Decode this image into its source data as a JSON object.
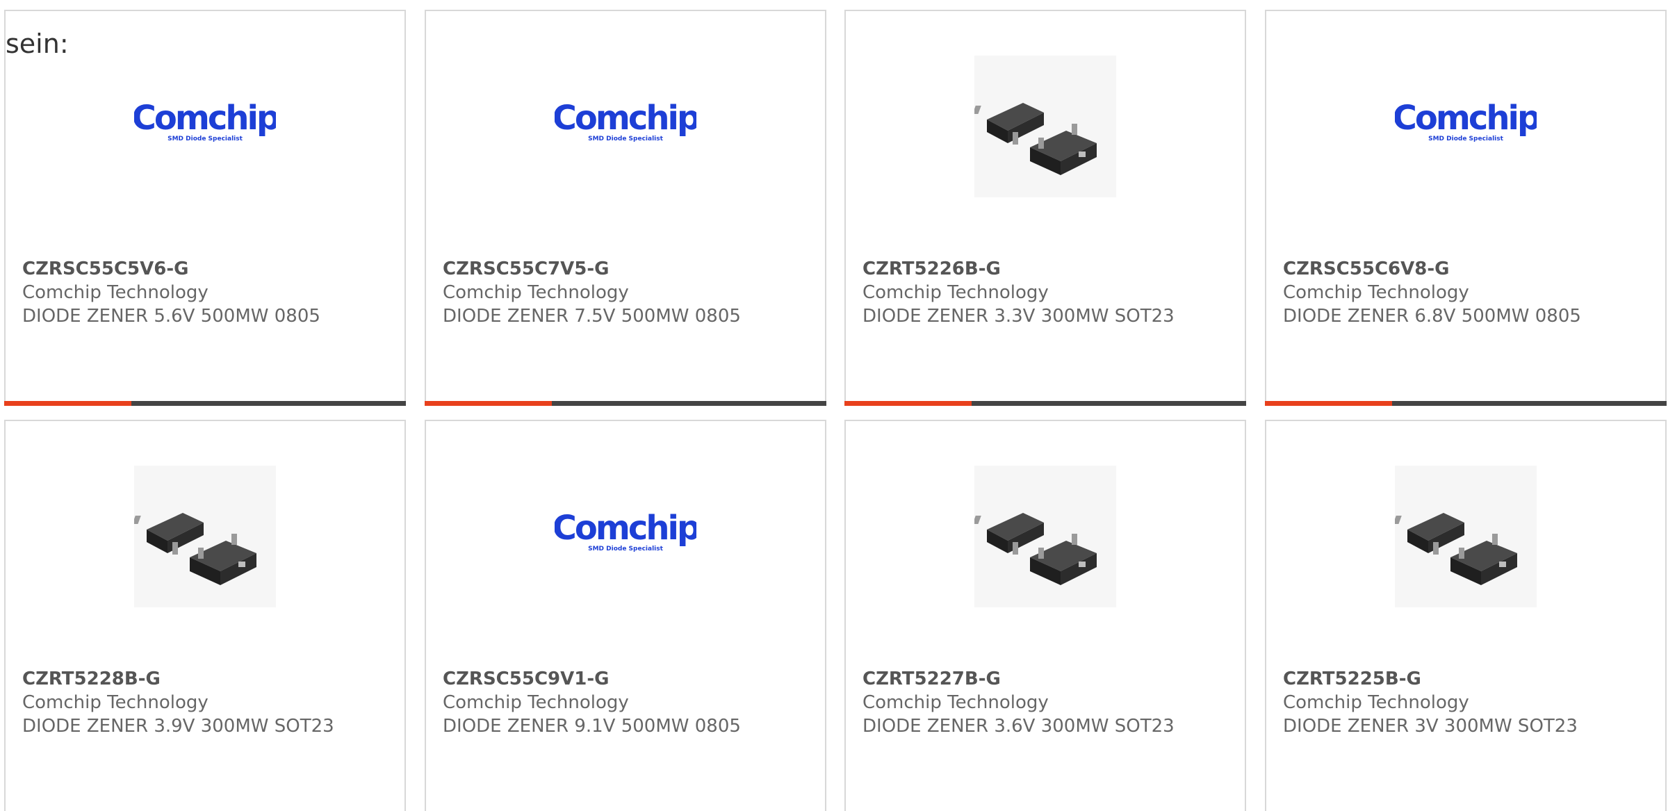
{
  "intro_text": "sein:",
  "colors": {
    "accent": "#e8401c",
    "bar_dark": "#444444",
    "logo_blue": "#1d3fd6"
  },
  "logo": {
    "brand": "Comchip",
    "tagline": "SMD Diode Specialist"
  },
  "products": [
    {
      "part": "CZRSC55C5V6-G",
      "maker": "Comchip Technology",
      "desc": "DIODE ZENER 5.6V 500MW 0805",
      "image": "comchip-logo"
    },
    {
      "part": "CZRSC55C7V5-G",
      "maker": "Comchip Technology",
      "desc": "DIODE ZENER 7.5V 500MW 0805",
      "image": "comchip-logo"
    },
    {
      "part": "CZRT5226B-G",
      "maker": "Comchip Technology",
      "desc": "DIODE ZENER 3.3V 300MW SOT23",
      "image": "sot23-photo"
    },
    {
      "part": "CZRSC55C6V8-G",
      "maker": "Comchip Technology",
      "desc": "DIODE ZENER 6.8V 500MW 0805",
      "image": "comchip-logo"
    },
    {
      "part": "CZRT5228B-G",
      "maker": "Comchip Technology",
      "desc": "DIODE ZENER 3.9V 300MW SOT23",
      "image": "sot23-photo"
    },
    {
      "part": "CZRSC55C9V1-G",
      "maker": "Comchip Technology",
      "desc": "DIODE ZENER 9.1V 500MW 0805",
      "image": "comchip-logo"
    },
    {
      "part": "CZRT5227B-G",
      "maker": "Comchip Technology",
      "desc": "DIODE ZENER 3.6V 300MW SOT23",
      "image": "sot23-photo"
    },
    {
      "part": "CZRT5225B-G",
      "maker": "Comchip Technology",
      "desc": "DIODE ZENER 3V 300MW SOT23",
      "image": "sot23-photo"
    }
  ]
}
